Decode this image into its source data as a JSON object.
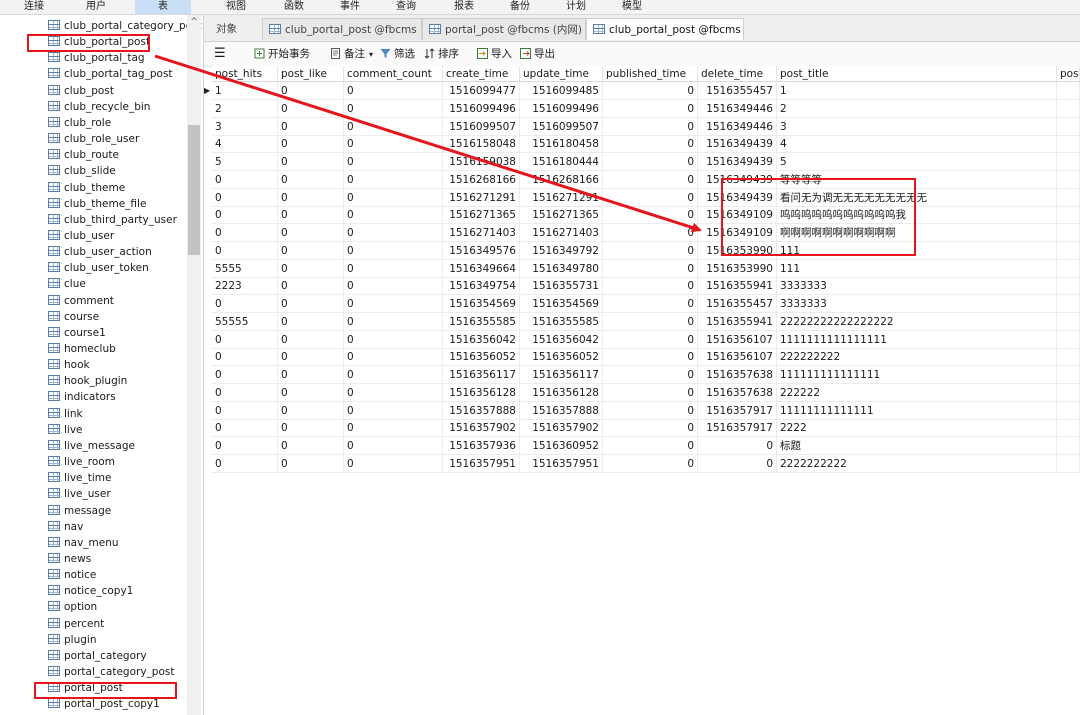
{
  "menu": [
    "连接",
    "用户",
    "表",
    "视图",
    "函数",
    "事件",
    "查询",
    "报表",
    "备份",
    "计划",
    "模型"
  ],
  "menu_active": "表",
  "sidebar": {
    "items": [
      "club_portal_category_post",
      "club_portal_post",
      "club_portal_tag",
      "club_portal_tag_post",
      "club_post",
      "club_recycle_bin",
      "club_role",
      "club_role_user",
      "club_route",
      "club_slide",
      "club_theme",
      "club_theme_file",
      "club_third_party_user",
      "club_user",
      "club_user_action",
      "club_user_token",
      "clue",
      "comment",
      "course",
      "course1",
      "homeclub",
      "hook",
      "hook_plugin",
      "indicators",
      "link",
      "live",
      "live_message",
      "live_room",
      "live_time",
      "live_user",
      "message",
      "nav",
      "nav_menu",
      "news",
      "notice",
      "notice_copy1",
      "option",
      "percent",
      "plugin",
      "portal_category",
      "portal_category_post",
      "portal_post",
      "portal_post_copy1"
    ],
    "highlighted": [
      "club_portal_post",
      "portal_post"
    ]
  },
  "tabs": [
    "对象",
    "club_portal_post @fbcms (...",
    "portal_post @fbcms (内网) -...",
    "club_portal_post @fbcms (..."
  ],
  "toolbar": {
    "menu_glyph": "☰",
    "begin_tx": "开始事务",
    "note": "备注",
    "filter": "筛选",
    "sort": "排序",
    "import": "导入",
    "export": "导出"
  },
  "table": {
    "columns": [
      "post_hits",
      "post_like",
      "comment_count",
      "create_time",
      "update_time",
      "published_time",
      "delete_time",
      "post_title",
      "post"
    ],
    "rows": [
      [
        "1",
        "0",
        "0",
        "1516099477",
        "1516099485",
        "0",
        "1516355457",
        "1"
      ],
      [
        "2",
        "0",
        "0",
        "1516099496",
        "1516099496",
        "0",
        "1516349446",
        "2"
      ],
      [
        "3",
        "0",
        "0",
        "1516099507",
        "1516099507",
        "0",
        "1516349446",
        "3"
      ],
      [
        "4",
        "0",
        "0",
        "1516158048",
        "1516180458",
        "0",
        "1516349439",
        "4"
      ],
      [
        "5",
        "0",
        "0",
        "1516159038",
        "1516180444",
        "0",
        "1516349439",
        "5"
      ],
      [
        "0",
        "0",
        "0",
        "1516268166",
        "1516268166",
        "0",
        "1516349439",
        "等等等等"
      ],
      [
        "0",
        "0",
        "0",
        "1516271291",
        "1516271291",
        "0",
        "1516349439",
        "看问无为调无无无无无无无无无"
      ],
      [
        "0",
        "0",
        "0",
        "1516271365",
        "1516271365",
        "0",
        "1516349109",
        "呜呜呜呜呜呜呜呜呜呜呜我"
      ],
      [
        "0",
        "0",
        "0",
        "1516271403",
        "1516271403",
        "0",
        "1516349109",
        "啊啊啊啊啊啊啊啊啊啊啊"
      ],
      [
        "0",
        "0",
        "0",
        "1516349576",
        "1516349792",
        "0",
        "1516353990",
        "111"
      ],
      [
        "5555",
        "0",
        "0",
        "1516349664",
        "1516349780",
        "0",
        "1516353990",
        "111"
      ],
      [
        "2223",
        "0",
        "0",
        "1516349754",
        "1516355731",
        "0",
        "1516355941",
        "3333333"
      ],
      [
        "0",
        "0",
        "0",
        "1516354569",
        "1516354569",
        "0",
        "1516355457",
        "3333333"
      ],
      [
        "55555",
        "0",
        "0",
        "1516355585",
        "1516355585",
        "0",
        "1516355941",
        "22222222222222222"
      ],
      [
        "0",
        "0",
        "0",
        "1516356042",
        "1516356042",
        "0",
        "1516356107",
        "1111111111111111"
      ],
      [
        "0",
        "0",
        "0",
        "1516356052",
        "1516356052",
        "0",
        "1516356107",
        "222222222"
      ],
      [
        "0",
        "0",
        "0",
        "1516356117",
        "1516356117",
        "0",
        "1516357638",
        "111111111111111"
      ],
      [
        "0",
        "0",
        "0",
        "1516356128",
        "1516356128",
        "0",
        "1516357638",
        "222222"
      ],
      [
        "0",
        "0",
        "0",
        "1516357888",
        "1516357888",
        "0",
        "1516357917",
        "11111111111111"
      ],
      [
        "0",
        "0",
        "0",
        "1516357902",
        "1516357902",
        "0",
        "1516357917",
        "2222"
      ],
      [
        "0",
        "0",
        "0",
        "1516357936",
        "1516360952",
        "0",
        "0",
        "标题"
      ],
      [
        "0",
        "0",
        "0",
        "1516357951",
        "1516357951",
        "0",
        "0",
        "2222222222"
      ]
    ]
  },
  "colors": {
    "annotation_red": "#e8141c",
    "menu_active_bg": "#c9dff5"
  }
}
